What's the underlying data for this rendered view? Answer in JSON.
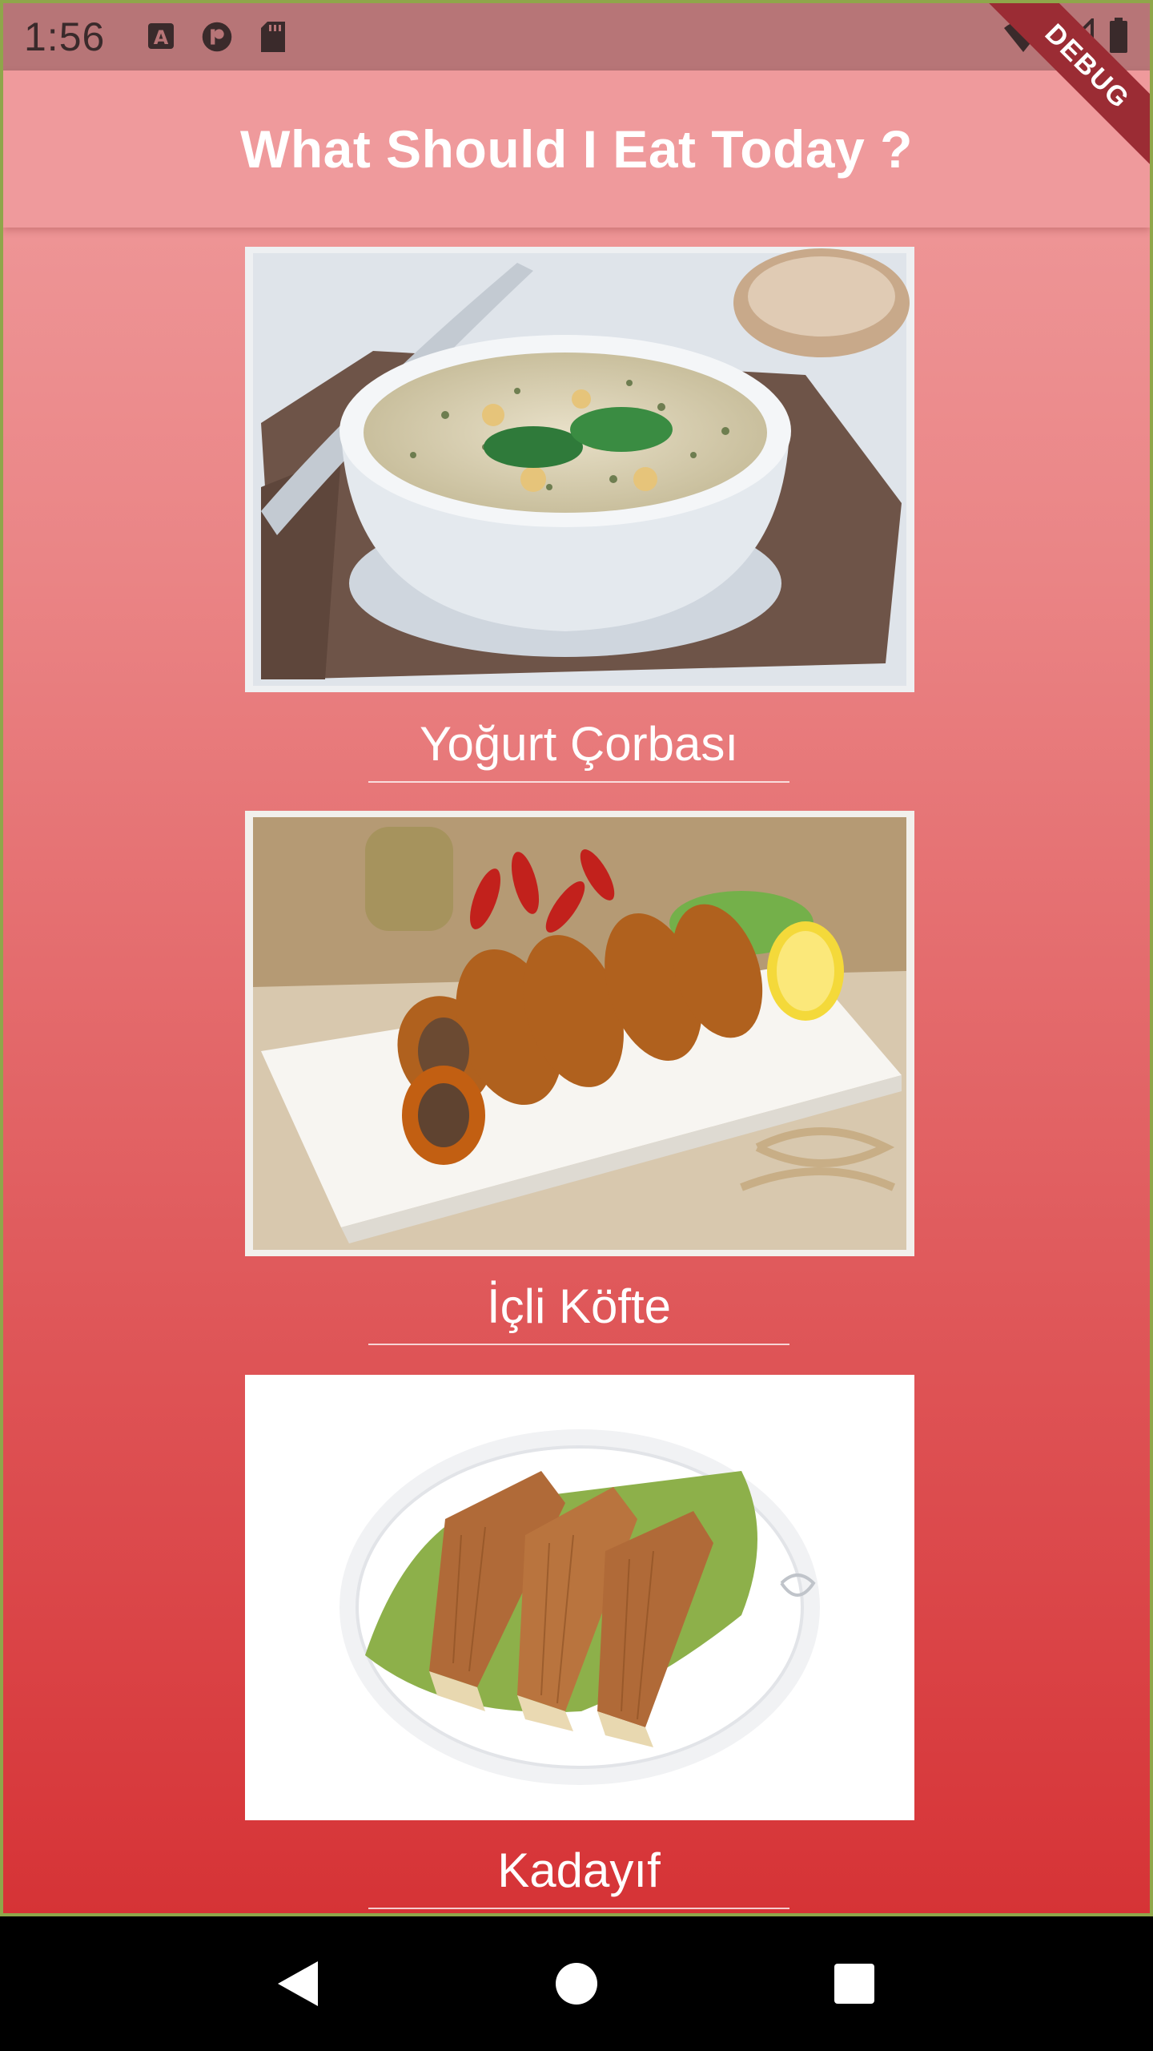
{
  "status_bar": {
    "time": "1:56",
    "icons": [
      "a-notification-icon",
      "p-notification-icon",
      "sd-card-icon"
    ],
    "right_icons": [
      "wifi-icon",
      "cell-signal-icon",
      "battery-icon"
    ]
  },
  "app_bar": {
    "title": "What Should I Eat Today ?",
    "debug_label": "DEBUG"
  },
  "foods": [
    {
      "name": "Yoğurt Çorbası",
      "image": "yogurt-soup-image"
    },
    {
      "name": "İçli Köfte",
      "image": "icli-kofte-image"
    },
    {
      "name": "Kadayıf",
      "image": "kadayif-image"
    }
  ],
  "nav_bar": {
    "buttons": [
      "back-icon",
      "home-icon",
      "recents-icon"
    ]
  },
  "colors": {
    "app_bar": "#ef9a9c",
    "gradient_top": "#f09fa0",
    "gradient_bottom": "#d63336",
    "debug_banner": "#9b2c34"
  }
}
